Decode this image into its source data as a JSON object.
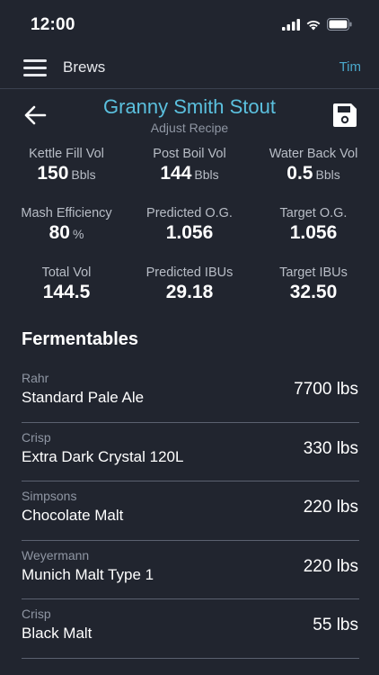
{
  "status_bar": {
    "time": "12:00"
  },
  "nav": {
    "title": "Brews",
    "user": "Tim"
  },
  "header": {
    "title": "Granny Smith Stout",
    "subtitle": "Adjust Recipe"
  },
  "stats": [
    {
      "label": "Kettle Fill Vol",
      "value": "150",
      "unit": "Bbls"
    },
    {
      "label": "Post Boil Vol",
      "value": "144",
      "unit": "Bbls"
    },
    {
      "label": "Water Back Vol",
      "value": "0.5",
      "unit": "Bbls"
    },
    {
      "label": "Mash Efficiency",
      "value": "80",
      "unit": "%"
    },
    {
      "label": "Predicted O.G.",
      "value": "1.056",
      "unit": ""
    },
    {
      "label": "Target O.G.",
      "value": "1.056",
      "unit": ""
    },
    {
      "label": "Total Vol",
      "value": "144.5",
      "unit": ""
    },
    {
      "label": "Predicted IBUs",
      "value": "29.18",
      "unit": ""
    },
    {
      "label": "Target IBUs",
      "value": "32.50",
      "unit": ""
    }
  ],
  "fermentables": {
    "title": "Fermentables",
    "items": [
      {
        "supplier": "Rahr",
        "name": "Standard Pale Ale",
        "amount": "7700 lbs"
      },
      {
        "supplier": "Crisp",
        "name": "Extra Dark Crystal 120L",
        "amount": "330 lbs"
      },
      {
        "supplier": "Simpsons",
        "name": "Chocolate Malt",
        "amount": "220 lbs"
      },
      {
        "supplier": "Weyermann",
        "name": "Munich Malt Type 1",
        "amount": "220 lbs"
      },
      {
        "supplier": "Crisp",
        "name": "Black Malt",
        "amount": "55 lbs"
      }
    ]
  },
  "colors": {
    "background": "#21252f",
    "accent": "#5bc0de",
    "user_link": "#4aa8cc"
  },
  "icons": [
    "signal-icon",
    "wifi-icon",
    "battery-icon",
    "menu-icon",
    "back-arrow-icon",
    "save-icon"
  ]
}
